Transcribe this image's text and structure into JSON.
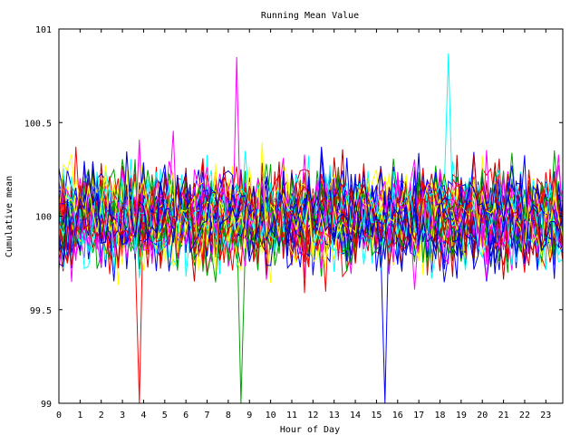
{
  "chart_data": {
    "type": "line",
    "title": "Running Mean Value",
    "xlabel": "Hour of Day",
    "ylabel": "Cumulative mean",
    "xlim": [
      0,
      23.8
    ],
    "ylim": [
      99,
      101
    ],
    "x_ticks": [
      0,
      1,
      2,
      3,
      4,
      5,
      6,
      7,
      8,
      9,
      10,
      11,
      12,
      13,
      14,
      15,
      16,
      17,
      18,
      19,
      20,
      21,
      22,
      23
    ],
    "x_tick_labels": [
      "0",
      "1",
      "2",
      "3",
      "4",
      "5",
      "6",
      "7",
      "8",
      "9",
      "10",
      "11",
      "12",
      "13",
      "14",
      "15",
      "16",
      "17",
      "18",
      "19",
      "20",
      "21",
      "22",
      "23"
    ],
    "y_ticks": [
      99,
      99.5,
      100,
      100.5,
      101
    ],
    "y_tick_labels": [
      "99",
      "99.5",
      "100",
      "100.5",
      "101"
    ],
    "grid": false,
    "legend": "none",
    "series_colors": [
      "#ff0000",
      "#00a000",
      "#0000ff",
      "#ff00ff",
      "#00ffff",
      "#ffff00",
      "#c00000",
      "#0000c0"
    ],
    "series_count": 40,
    "series_points": 120,
    "center_value": 100,
    "typical_band": [
      99.6,
      100.4
    ],
    "observed_extremes": [
      {
        "x": 3.75,
        "y": 99.0
      },
      {
        "x": 8.6,
        "y": 99.0
      },
      {
        "x": 15.5,
        "y": 99.0
      },
      {
        "x": 8.5,
        "y": 100.85
      },
      {
        "x": 18.5,
        "y": 100.87
      }
    ]
  }
}
